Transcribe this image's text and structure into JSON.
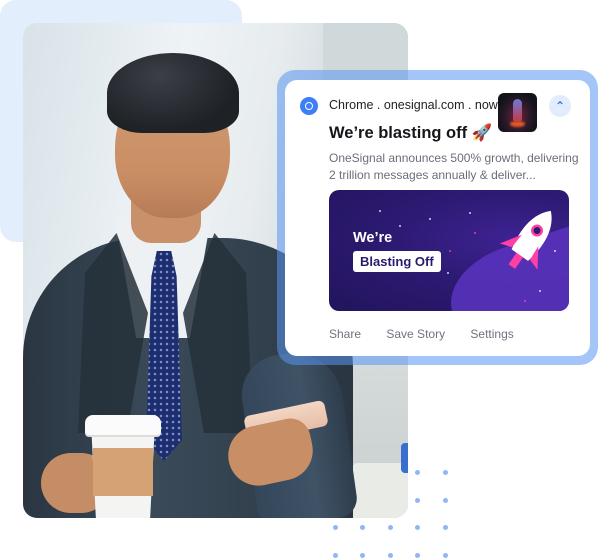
{
  "notification": {
    "source": "Chrome . onesignal.com . now",
    "title": "We’re blasting off 🚀",
    "body": "OneSignal announces 500% growth, delivering 2 trillion messages annually & deliver...",
    "collapse_icon": "chevron-up-icon",
    "app_icon": "chrome-icon",
    "banner": {
      "line1": "We’re",
      "line2": "Blasting Off"
    },
    "actions": [
      "Share",
      "Save Story",
      "Settings"
    ]
  },
  "colors": {
    "accent": "#2e6ff0",
    "frame": "#9cc2f7",
    "banner_bg": "#2d1a73",
    "rocket_pink": "#ff3fa4",
    "dots": "#8fb6f7"
  }
}
